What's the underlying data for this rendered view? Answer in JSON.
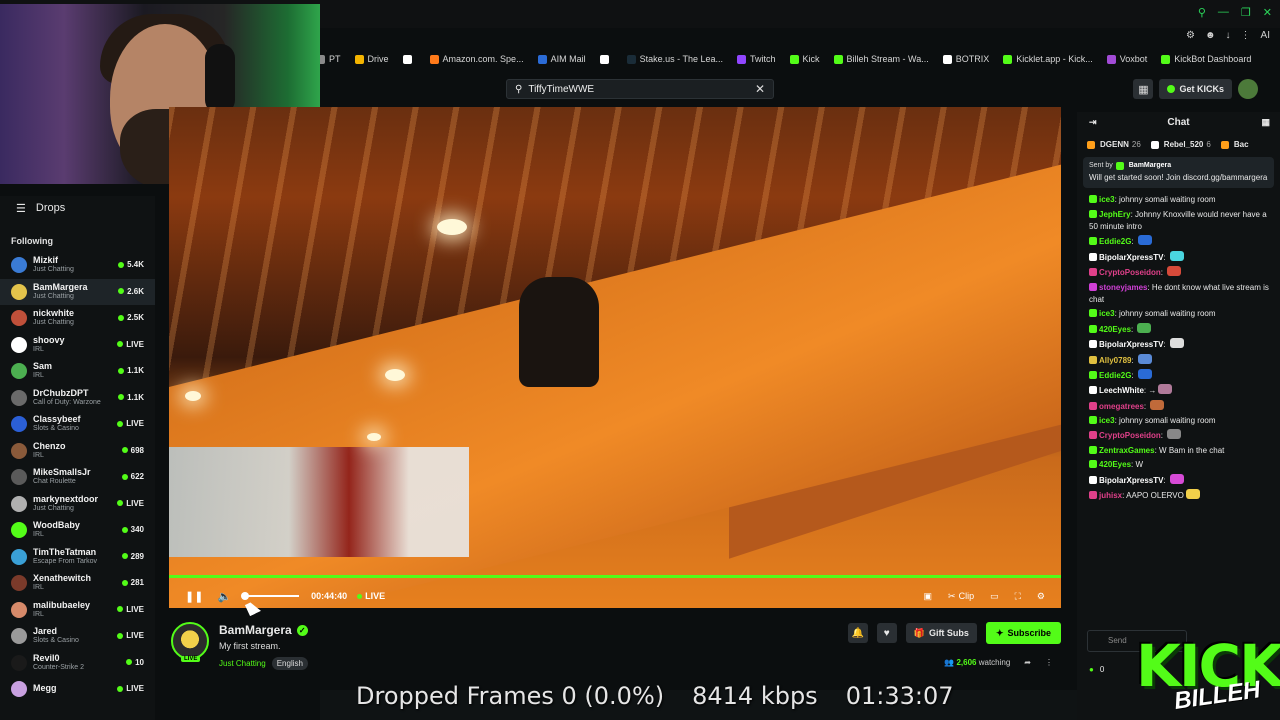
{
  "browser": {
    "bookmarks": [
      {
        "label": "PT",
        "color": "#8a8a8a"
      },
      {
        "label": "Drive",
        "color": "#f4b400"
      },
      {
        "label": "",
        "color": "#ffffff"
      },
      {
        "label": "Amazon.com. Spe...",
        "color": "#ff7a1a"
      },
      {
        "label": "AIM Mail",
        "color": "#2b6bd6"
      },
      {
        "label": "",
        "color": "#ffffff"
      },
      {
        "label": "Stake.us - The Lea...",
        "color": "#1a2c38"
      },
      {
        "label": "Twitch",
        "color": "#9146ff"
      },
      {
        "label": "Kick",
        "color": "#53fc18"
      },
      {
        "label": "Billeh Stream - Wa...",
        "color": "#53fc18"
      },
      {
        "label": "BOTRIX",
        "color": "#ffffff"
      },
      {
        "label": "Kicklet.app - Kick...",
        "color": "#53fc18"
      },
      {
        "label": "Voxbot",
        "color": "#a24bd6"
      },
      {
        "label": "KickBot Dashboard",
        "color": "#53fc18"
      }
    ],
    "ai_label": "AI"
  },
  "search": {
    "value": "TiffyTimeWWE"
  },
  "topbar": {
    "get_kicks": "Get KICKs"
  },
  "sidebar": {
    "drops_label": "Drops",
    "following_label": "Following",
    "channels": [
      {
        "name": "Mizkif",
        "category": "Just Chatting",
        "count": "5.4K",
        "color": "#3a7bd5"
      },
      {
        "name": "BamMargera",
        "category": "Just Chatting",
        "count": "2.6K",
        "color": "#e3c34b",
        "active": true
      },
      {
        "name": "nickwhite",
        "category": "Just Chatting",
        "count": "2.5K",
        "color": "#c0503a"
      },
      {
        "name": "shoovy",
        "category": "IRL",
        "count": "LIVE",
        "color": "#ffffff"
      },
      {
        "name": "Sam",
        "category": "IRL",
        "count": "1.1K",
        "color": "#4caf50"
      },
      {
        "name": "DrChubzDPT",
        "category": "Call of Duty: Warzone",
        "count": "1.1K",
        "color": "#6a6a6a"
      },
      {
        "name": "Classybeef",
        "category": "Slots & Casino",
        "count": "LIVE",
        "color": "#2b5fd6"
      },
      {
        "name": "Chenzo",
        "category": "IRL",
        "count": "698",
        "color": "#8a5a3a"
      },
      {
        "name": "MikeSmallsJr",
        "category": "Chat Roulette",
        "count": "622",
        "color": "#5a5a5a"
      },
      {
        "name": "markynextdoor",
        "category": "Just Chatting",
        "count": "LIVE",
        "color": "#b0b0b0"
      },
      {
        "name": "WoodBaby",
        "category": "IRL",
        "count": "340",
        "color": "#53fc18"
      },
      {
        "name": "TimTheTatman",
        "category": "Escape From Tarkov",
        "count": "289",
        "color": "#3aa0d6"
      },
      {
        "name": "Xenathewitch",
        "category": "IRL",
        "count": "281",
        "color": "#7a3a2a"
      },
      {
        "name": "malibubaeley",
        "category": "IRL",
        "count": "LIVE",
        "color": "#d68a6a"
      },
      {
        "name": "Jared",
        "category": "Slots & Casino",
        "count": "LIVE",
        "color": "#9a9a9a"
      },
      {
        "name": "Revil0",
        "category": "Counter-Strike 2",
        "count": "10",
        "color": "#1a1a1a"
      },
      {
        "name": "Megg",
        "category": "",
        "count": "LIVE",
        "color": "#c8a0e0"
      }
    ]
  },
  "player": {
    "time": "00:44:40",
    "live_label": "LIVE",
    "clip_label": "Clip",
    "progress": 1.0
  },
  "stream": {
    "live_tag": "LIVE",
    "channel_name": "BamMargera",
    "title": "My first stream.",
    "category": "Just Chatting",
    "language": "English",
    "gift_subs_label": "Gift Subs",
    "subscribe_label": "Subscribe",
    "viewers": "2,606",
    "watching_label": "watching"
  },
  "chat": {
    "header": "Chat",
    "gifters": [
      {
        "name": "DGENN",
        "count": "26",
        "color": "#ff9f1a"
      },
      {
        "name": "Rebel_520",
        "count": "6",
        "color": "#ffffff"
      },
      {
        "name": "Bac",
        "count": "",
        "color": "#ff9f1a"
      }
    ],
    "pinned": {
      "sent_by_label": "Sent by",
      "sender": "BamMargera",
      "text": "Will get started soon! Join discord.gg/bammargera"
    },
    "messages": [
      {
        "user": "ice3",
        "text": "johnny somali waiting room",
        "color": "#53fc18",
        "emote": ""
      },
      {
        "user": "JephEry",
        "text": "Johnny Knoxville would never have a 50 minute intro",
        "color": "#53fc18",
        "emote": ""
      },
      {
        "user": "Eddie2G",
        "text": "",
        "color": "#53fc18",
        "emote": "#2a6bd6"
      },
      {
        "user": "BipolarXpressTV",
        "text": "",
        "color": "#ffffff",
        "emote": "#4ad6e0"
      },
      {
        "user": "CryptoPoseidon",
        "text": "",
        "color": "#e0408a",
        "emote": "#d64a3a"
      },
      {
        "user": "stoneyjames",
        "text": "He dont know what live stream is chat",
        "color": "#d040d6",
        "emote": ""
      },
      {
        "user": "ice3",
        "text": "johnny somali waiting room",
        "color": "#53fc18",
        "emote": ""
      },
      {
        "user": "420Eyes",
        "text": "",
        "color": "#53fc18",
        "emote": "#4caf50"
      },
      {
        "user": "BipolarXpressTV",
        "text": "",
        "color": "#ffffff",
        "emote": "#dddddd"
      },
      {
        "user": "Ally0789",
        "text": "",
        "color": "#e0c040",
        "emote": "#5a8ad6"
      },
      {
        "user": "Eddie2G",
        "text": "",
        "color": "#53fc18",
        "emote": "#2a6bd6"
      },
      {
        "user": "LeechWhite",
        "text": "→",
        "color": "#ffffff",
        "emote": "#b07a9a"
      },
      {
        "user": "omegatrees",
        "text": "",
        "color": "#e0408a",
        "emote": "#c06a3a"
      },
      {
        "user": "ice3",
        "text": "johnny somali waiting room",
        "color": "#53fc18",
        "emote": ""
      },
      {
        "user": "CryptoPoseidon",
        "text": "",
        "color": "#e0408a",
        "emote": "#888888"
      },
      {
        "user": "ZentraxGames",
        "text": "W Bam in the chat",
        "color": "#53fc18",
        "emote": ""
      },
      {
        "user": "420Eyes",
        "text": "W",
        "color": "#53fc18",
        "emote": ""
      },
      {
        "user": "BipolarXpressTV",
        "text": "",
        "color": "#ffffff",
        "emote": "#d64ad6"
      },
      {
        "user": "juhisx",
        "text": "AAPO OLERVO",
        "color": "#e0408a",
        "emote": "#f2d04a"
      }
    ],
    "input_placeholder": "Send",
    "bottom_count": "0"
  },
  "overlay": {
    "logo_text": "KICK",
    "logo_sub": "BILLEH",
    "dropped_frames": "Dropped Frames 0 (0.0%)",
    "bitrate": "8414 kbps",
    "uptime": "01:33:07"
  }
}
